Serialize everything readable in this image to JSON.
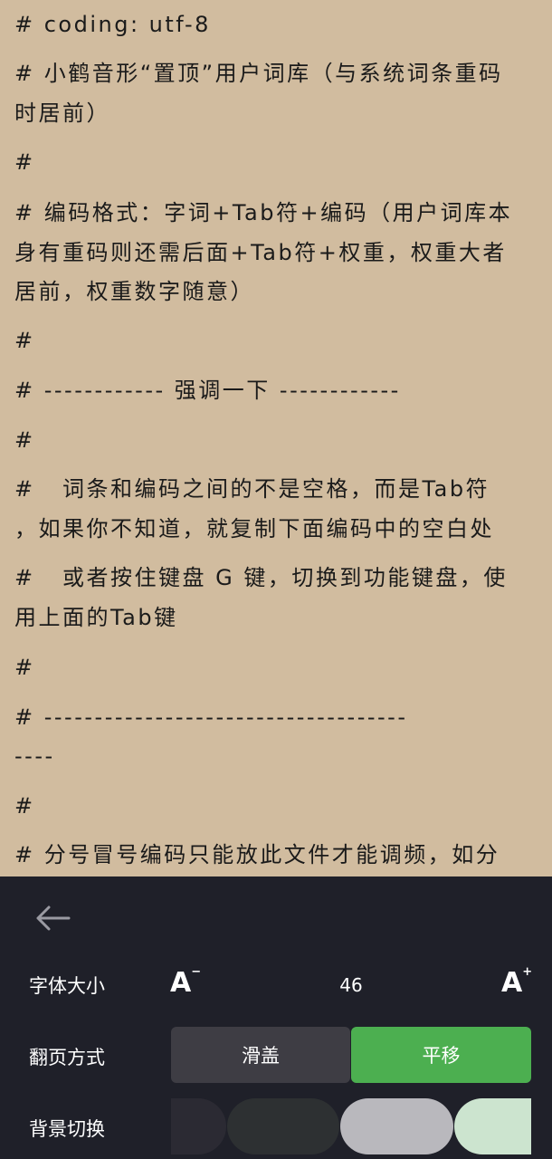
{
  "reader": {
    "lines": [
      "# coding: utf-8",
      "# 小鹤音形“置顶”用户词库（与系统词条重码",
      "时居前）",
      "#",
      "# 编码格式：字词+Tab符+编码（用户词库本",
      "身有重码则还需后面+Tab符+权重，权重大者",
      "居前，权重数字随意）",
      "#",
      "# ------------ 强调一下 ------------",
      "#",
      "#   词条和编码之间的不是空格，而是Tab符",
      "，如果你不知道，就复制下面编码中的空白处",
      "#   或者按住键盘 G 键，切换到功能键盘，使",
      "用上面的Tab键",
      "#",
      "# ------------------------------------",
      "----",
      "#",
      "# 分号冒号编码只能放此文件才能调频，如分"
    ]
  },
  "panel": {
    "back_icon": "arrow-left-icon",
    "font_size": {
      "label": "字体大小",
      "decrease_label": "A",
      "decrease_mark": "−",
      "increase_label": "A",
      "increase_mark": "+",
      "value": "46"
    },
    "page_turn": {
      "label": "翻页方式",
      "options": [
        "滑盖",
        "平移"
      ],
      "selected": "平移"
    },
    "background": {
      "label": "背景切换",
      "swatches": [
        "#2b2a33",
        "#2d3032",
        "#b9b8bd",
        "#cce4cf"
      ]
    }
  },
  "colors": {
    "page_bg": "#d1bc9f",
    "text": "#1a1a1a",
    "panel_bg": "#1f2029",
    "segment_inactive": "#3e3d44",
    "segment_active": "#4caf50"
  }
}
